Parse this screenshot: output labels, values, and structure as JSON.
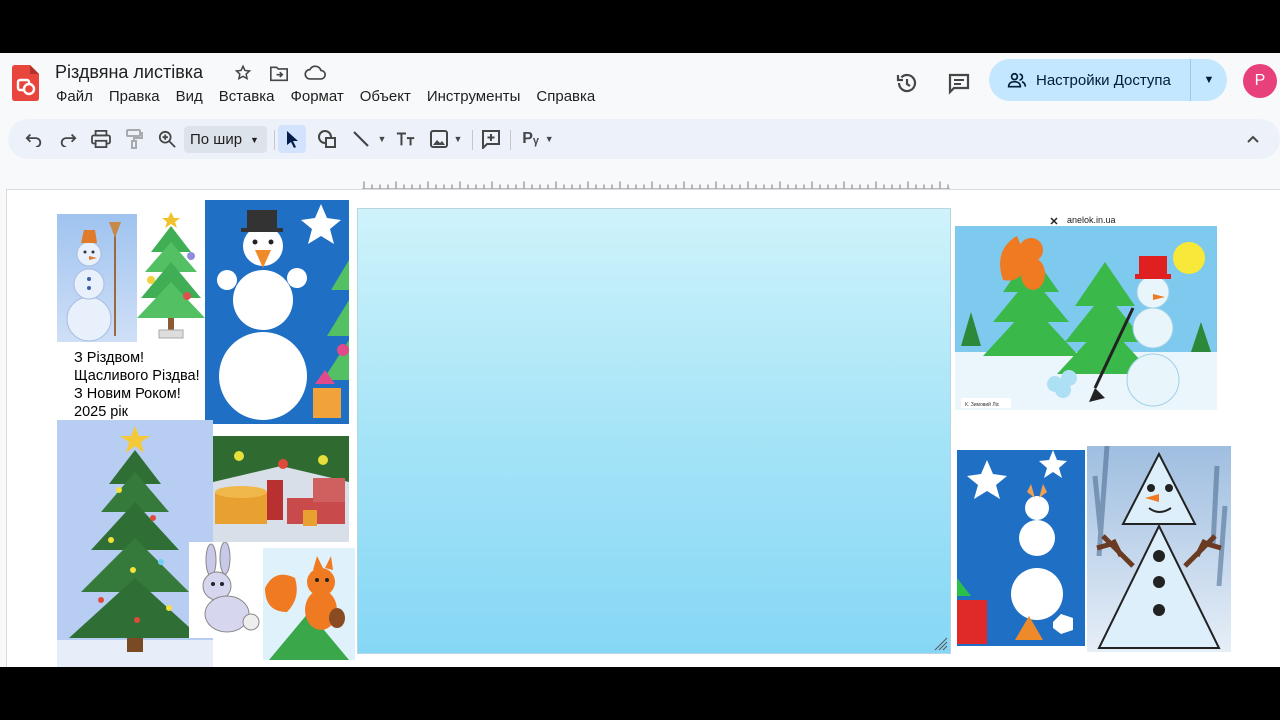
{
  "app": {
    "doc_title": "Різдвяна листівка",
    "menu": [
      "Файл",
      "Правка",
      "Вид",
      "Вставка",
      "Формат",
      "Объект",
      "Инструменты",
      "Справка"
    ],
    "share_label": "Настройки Доступа",
    "avatar_letter": "P"
  },
  "toolbar": {
    "zoom_label": "По шир",
    "icons": [
      "undo-icon",
      "redo-icon",
      "print-icon",
      "paint-format-icon",
      "zoom-icon",
      "select-arrow-icon",
      "shapes-icon",
      "line-icon",
      "textbox-icon",
      "image-icon",
      "comment-add-icon",
      "input-tools-icon",
      "collapse-icon"
    ]
  },
  "slide": {
    "greeting_lines": [
      "З Різдвом!",
      "Щасливого Різдва!",
      "З Новим Роком!",
      "2025 рік"
    ],
    "watermark_text": "anelok.in.ua",
    "caption_text": "К. Зимовий Ліс"
  },
  "colors": {
    "accent_share": "#c2e7ff",
    "avatar": "#e8407a",
    "toolbar_bg": "#edf2fa",
    "textbox_top": "#cff3fb",
    "textbox_bottom": "#86d7f6",
    "logo": "#e8453c"
  }
}
